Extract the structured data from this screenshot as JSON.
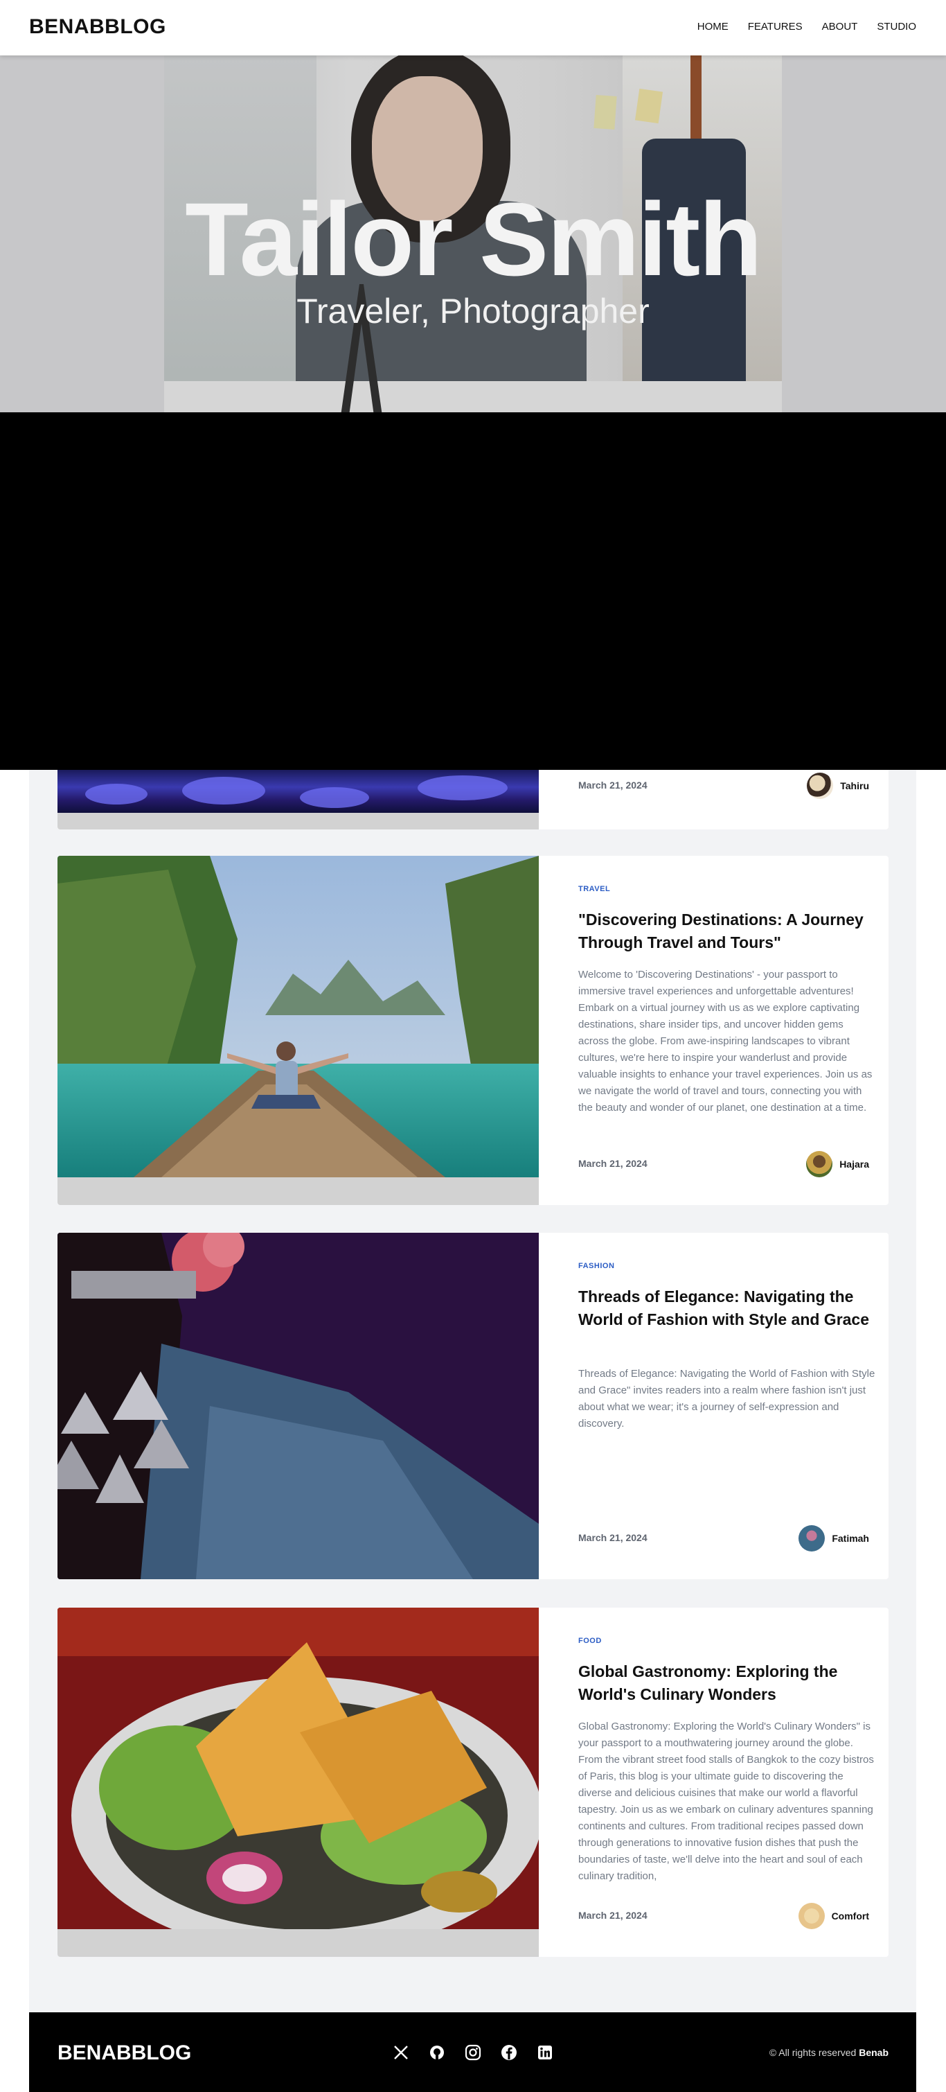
{
  "header": {
    "brand": "BENABBLOG",
    "nav": [
      "HOME",
      "FEATURES",
      "ABOUT",
      "STUDIO"
    ]
  },
  "hero": {
    "title": "Tailor Smith",
    "subtitle": "Traveler, Photographer"
  },
  "posts": [
    {
      "date": "March 21, 2024",
      "author": "Tahiru"
    },
    {
      "category": "TRAVEL",
      "title": "\"Discovering Destinations: A Journey Through Travel and Tours\"",
      "excerpt": "Welcome to 'Discovering Destinations' - your passport to immersive travel experiences and unforgettable adventures! Embark on a virtual journey with us as we explore captivating destinations, share insider tips, and uncover hidden gems across the globe. From awe-inspiring landscapes to vibrant cultures, we're here to inspire your wanderlust and provide valuable insights to enhance your travel experiences. Join us as we navigate the world of travel and tours, connecting you with the beauty and wonder of our planet, one destination at a time.",
      "date": "March 21, 2024",
      "author": "Hajara"
    },
    {
      "category": "FASHION",
      "title": "Threads of Elegance: Navigating the World of Fashion with Style and Grace",
      "excerpt": "Threads of Elegance: Navigating the World of Fashion with Style and Grace\" invites readers into a realm where fashion isn't just about what we wear; it's a journey of self-expression and discovery.",
      "date": "March 21, 2024",
      "author": "Fatimah"
    },
    {
      "category": "FOOD",
      "title": "Global Gastronomy: Exploring the World's Culinary Wonders",
      "excerpt": "Global Gastronomy: Exploring the World's Culinary Wonders\" is your passport to a mouthwatering journey around the globe. From the vibrant street food stalls of Bangkok to the cozy bistros of Paris, this blog is your ultimate guide to discovering the diverse and delicious cuisines that make our world a flavorful tapestry. Join us as we embark on culinary adventures spanning continents and cultures. From traditional recipes passed down through generations to innovative fusion dishes that push the boundaries of taste, we'll delve into the heart and soul of each culinary tradition,",
      "date": "March 21, 2024",
      "author": "Comfort"
    }
  ],
  "footer": {
    "brand": "BENABBLOG",
    "socials": [
      "x-icon",
      "github-icon",
      "instagram-icon",
      "facebook-icon",
      "linkedin-icon"
    ],
    "copyright_prefix": "© All rights reserved",
    "copyright_owner": "Benab"
  }
}
